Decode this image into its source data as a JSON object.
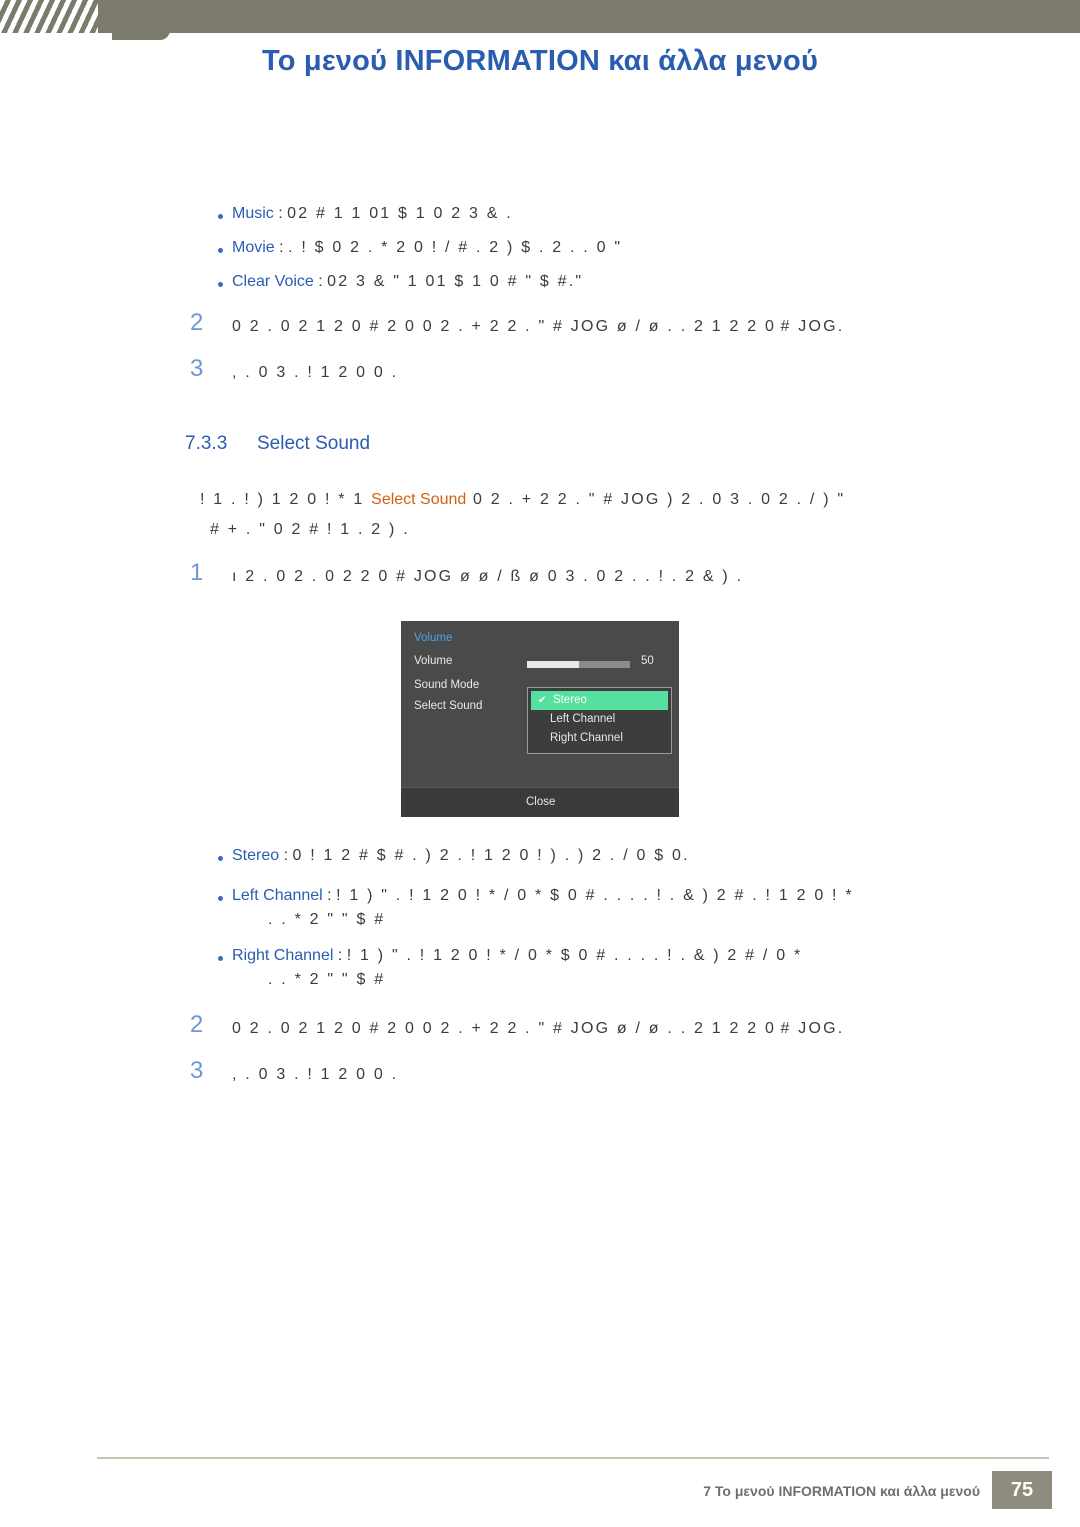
{
  "header": {
    "title_prefix": "Το μενού ",
    "title_info": "INFORMATION",
    "title_suffix": " και άλλα μενού"
  },
  "sound_modes": [
    {
      "term": "Music",
      "colon": " :",
      "text": "02    # 1   1 01 $  1  0 2 3 &   ."
    },
    {
      "term": "Movie",
      "colon": " :",
      "text": ". !  $ 0 2    .  * 2 0 ! / #  . 2 ) $   . 2 .   . 0 \""
    },
    {
      "term": "Clear Voice",
      "colon": " :",
      "text": "02  3 &   \" 1 01 $  1  0     # \"  $  #.\""
    }
  ],
  "steps_top": [
    {
      "num": "2",
      "line1": "0 2 .   0  2  1 2  0    #   2 0         0 2 .    +   2 2 . \"  #   JOG    ø    /  ø      .  . 2  1 2 2 0",
      "line2": "#    JOG."
    },
    {
      "num": "3",
      "line1": ", .   0 3 . !   1 2 0 0      .",
      "line2": ""
    }
  ],
  "section": {
    "number": "7.3.3",
    "title": "Select Sound"
  },
  "intro": {
    "pre": "!  1 . !  ) 1 2 0  !  *    1",
    "highlight": "Select Sound",
    "post": "0 2 .    +   2 2 . \"  #    JOG  ) 2 . 0 3 .    0 2 . /   ) \"",
    "cont": "#    +    . \" 0  2  # ! 1 . 2      )  ."
  },
  "step_one": {
    "num": "1",
    "text": "ı 2 .   0 2 .    0 2 2 0 #   JOG  ø         ø / ß    ø 0 3 .    0 2 . . ! .   2 &   )  ."
  },
  "osd": {
    "title": "Volume",
    "rows": [
      {
        "label": "Volume"
      },
      {
        "label": "Sound Mode"
      },
      {
        "label": "Select Sound"
      }
    ],
    "volume_value": "50",
    "options": [
      {
        "label": "Stereo",
        "selected": true,
        "check": "✔"
      },
      {
        "label": "Left Channel",
        "selected": false
      },
      {
        "label": "Right Channel",
        "selected": false
      }
    ],
    "close_label": "Close"
  },
  "channels": [
    {
      "term": "Stereo",
      "colon": " :",
      "line1": "0 !          1 2   # $  # .  ) 2 . !  1 2 0 ! )  .  ) 2 . / 0    $ 0.",
      "line2": ""
    },
    {
      "term": "Left Channel",
      "colon": " :",
      "line1": "!   1   ) \" . !   1 2 0 ! *  / 0     * $ 0   # . .  . . ! . &     )    2  # . !  1 2 0 ! *",
      "line2": ".  .      * 2  \"     \"    $  #"
    },
    {
      "term": "Right Channel",
      "colon": " :",
      "line1": "!   1   ) \" . !   1 2 0 ! *  / 0     * $ 0   # . .  . . ! . &     )    2  # / 0      *",
      "line2": ".  .      * 2  \"     \"    $  #"
    }
  ],
  "steps_bottom": [
    {
      "num": "2",
      "line1": "0 2 .   0  2  1 2  0    #   2 0         0 2 .    +   2 2 . \"  #   JOG    ø    /  ø      .  . 2  1 2 2 0",
      "line2": "#    JOG."
    },
    {
      "num": "3",
      "line1": ", .   0 3 . !   1 2 0 0      .",
      "line2": ""
    }
  ],
  "footer": {
    "chapter": "7 ",
    "text_prefix": "Το μενού ",
    "text_info": "INFORMATION",
    "text_suffix": " και άλλα μενού",
    "page": "75"
  }
}
